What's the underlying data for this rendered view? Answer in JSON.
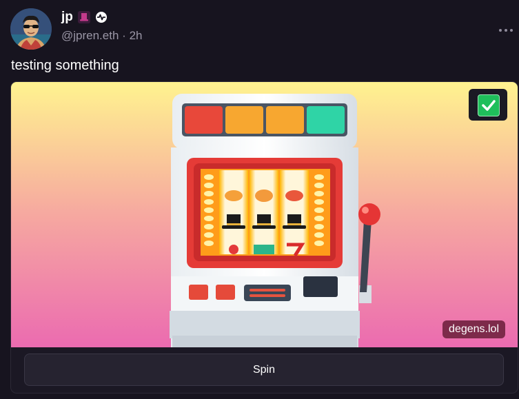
{
  "author": {
    "display_name": "jp",
    "handle": "@jpren.eth",
    "separator": "·",
    "time_ago": "2h"
  },
  "post": {
    "text": "testing something"
  },
  "frame": {
    "domain": "degens.lol",
    "button_label": "Spin",
    "image_subject": "slot machine",
    "gradient_colors": [
      "#fff38f",
      "#f6a8a0",
      "#eb6bb0"
    ]
  },
  "icons": {
    "badge_1": "top-hat-icon",
    "badge_2": "activity-pulse-icon",
    "more": "more-horizontal-icon",
    "check": "checkmark-icon"
  }
}
